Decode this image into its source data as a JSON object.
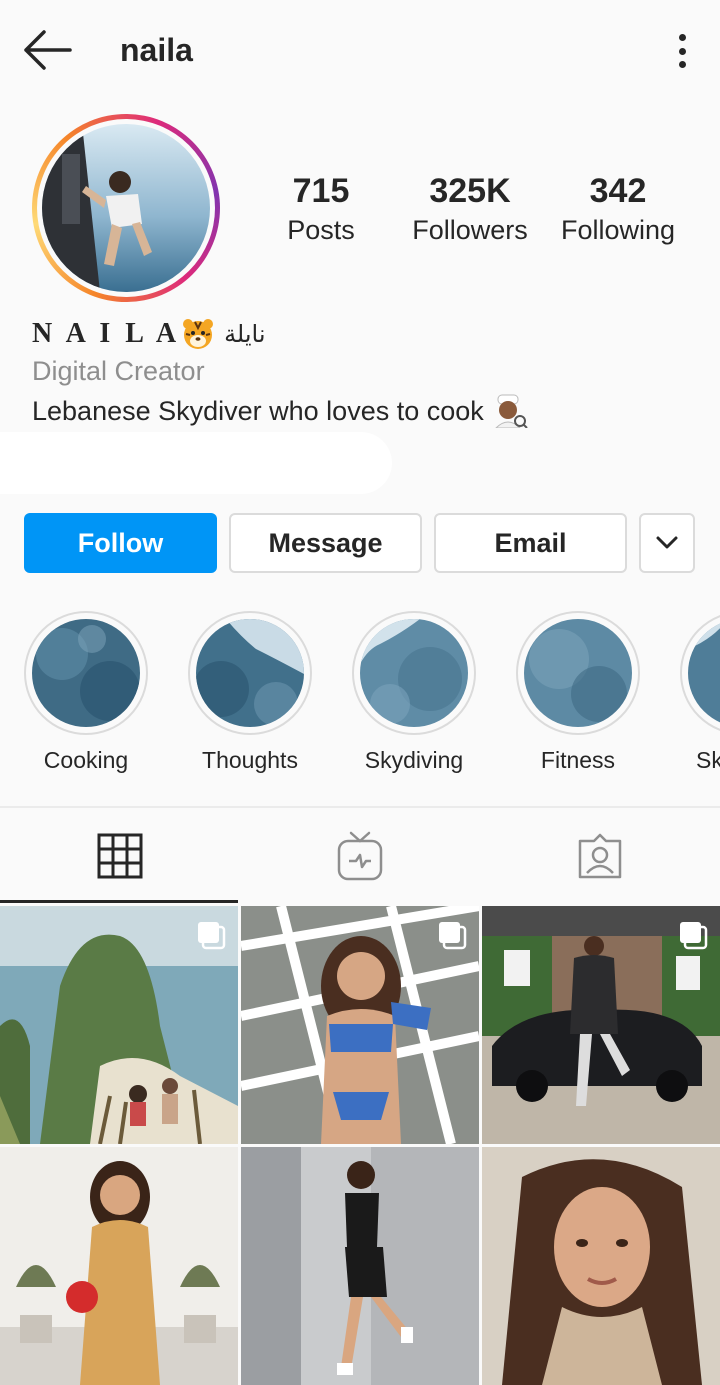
{
  "header": {
    "username": "naila"
  },
  "profile": {
    "stats": [
      {
        "value": "715",
        "label": "Posts"
      },
      {
        "value": "325K",
        "label": "Followers"
      },
      {
        "value": "342",
        "label": "Following"
      }
    ],
    "full_name": "N A I L A",
    "full_name_arabic": "نايلة",
    "category": "Digital Creator",
    "bio": "Lebanese Skydiver who loves to cook"
  },
  "actions": {
    "follow": "Follow",
    "message": "Message",
    "email": "Email"
  },
  "highlights": [
    {
      "label": "Cooking"
    },
    {
      "label": "Thoughts"
    },
    {
      "label": "Skydiving"
    },
    {
      "label": "Fitness"
    },
    {
      "label": "Sk"
    }
  ],
  "tabs": [
    "grid-icon",
    "igtv-icon",
    "tagged-icon"
  ],
  "colors": {
    "accent": "#0095f6",
    "text": "#262626",
    "muted": "#8e8e8e",
    "border": "#dbdbdb"
  }
}
